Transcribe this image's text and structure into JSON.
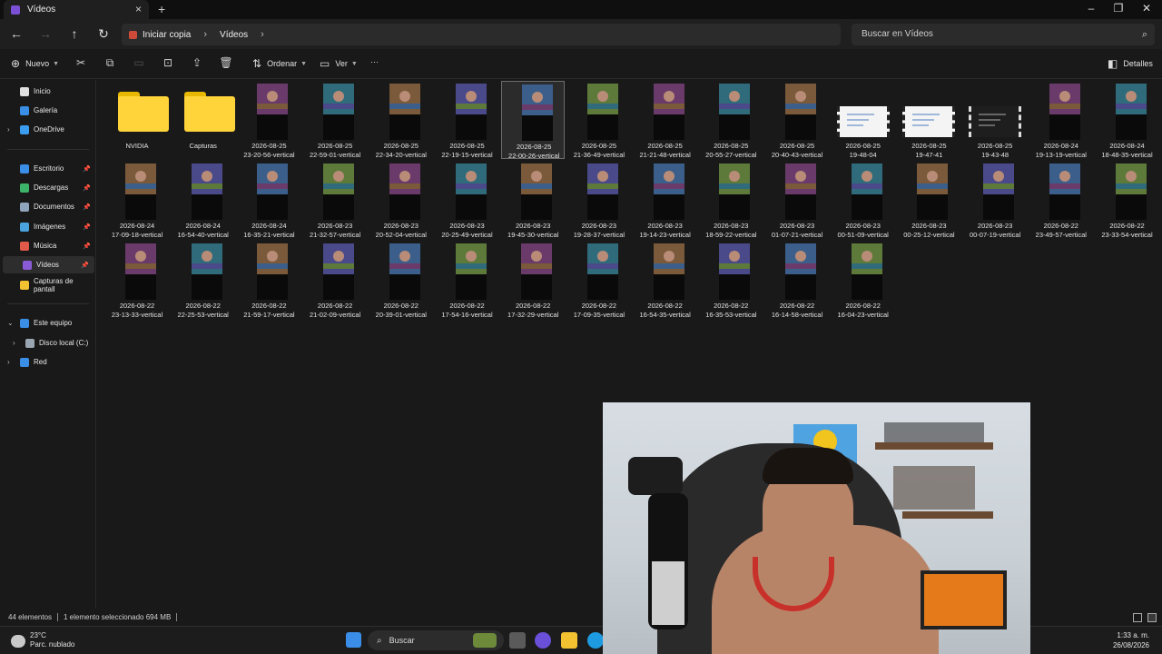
{
  "window": {
    "tab_title": "Vídeos",
    "new_tab": "+",
    "close_tab": "×",
    "minimize": "–",
    "maximize": "❐",
    "close": "✕"
  },
  "nav": {
    "back": "←",
    "forward": "→",
    "up": "↑",
    "refresh": "↻",
    "breadcrumbs": [
      "Iniciar copia",
      "Vídeos"
    ],
    "search_placeholder": "Buscar en Vídeos"
  },
  "commandbar": {
    "new_label": "Nuevo",
    "sort_label": "Ordenar",
    "view_label": "Ver",
    "more_label": "···",
    "details_label": "Detalles",
    "icons": [
      "cut-icon",
      "copy-icon",
      "paste-icon",
      "rename-icon",
      "share-icon",
      "delete-icon"
    ]
  },
  "sidebar": {
    "items": [
      {
        "label": "Inicio",
        "icon": "home-icon",
        "color": "#e0e0e0"
      },
      {
        "label": "Galería",
        "icon": "gallery-icon",
        "color": "#3a8ee6"
      },
      {
        "label": "OneDrive",
        "icon": "cloud-icon",
        "color": "#3b9cf0"
      },
      {
        "label": "Escritorio",
        "icon": "desktop-icon",
        "color": "#3a8ee6"
      },
      {
        "label": "Descargas",
        "icon": "download-icon",
        "color": "#3db36a"
      },
      {
        "label": "Documentos",
        "icon": "documents-icon",
        "color": "#8fa4bd"
      },
      {
        "label": "Imágenes",
        "icon": "pictures-icon",
        "color": "#4aa3df"
      },
      {
        "label": "Música",
        "icon": "music-icon",
        "color": "#e35a4a"
      },
      {
        "label": "Vídeos",
        "icon": "videos-icon",
        "color": "#8a5bd6"
      },
      {
        "label": "Capturas de pantall",
        "icon": "folder-icon",
        "color": "#f2c230"
      },
      {
        "label": "Este equipo",
        "icon": "computer-icon",
        "color": "#3a8ee6"
      },
      {
        "label": "Disco local (C:)",
        "icon": "drive-icon",
        "color": "#9aa6b2"
      },
      {
        "label": "Red",
        "icon": "network-icon",
        "color": "#3a8ee6"
      }
    ]
  },
  "files": [
    {
      "name": "NVIDIA",
      "kind": "folder"
    },
    {
      "name": "Capturas",
      "kind": "folder"
    },
    {
      "name": "2026-08-25\n23-20-56-vertical",
      "kind": "video"
    },
    {
      "name": "2026-08-25\n22-59-01-vertical",
      "kind": "video"
    },
    {
      "name": "2026-08-25\n22-34-20-vertical",
      "kind": "video"
    },
    {
      "name": "2026-08-25\n22-19-15-vertical",
      "kind": "video"
    },
    {
      "name": "2026-08-25\n22-00-26-vertical",
      "kind": "video",
      "selected": true
    },
    {
      "name": "2026-08-25\n21-36-49-vertical",
      "kind": "video"
    },
    {
      "name": "2026-08-25\n21-21-48-vertical",
      "kind": "video"
    },
    {
      "name": "2026-08-25\n20-55-27-vertical",
      "kind": "video"
    },
    {
      "name": "2026-08-25\n20-40-43-vertical",
      "kind": "video"
    },
    {
      "name": "2026-08-25\n19-48-04",
      "kind": "doc"
    },
    {
      "name": "2026-08-25\n19-47-41",
      "kind": "doc"
    },
    {
      "name": "2026-08-25\n19-43-48",
      "kind": "docdark"
    },
    {
      "name": "2026-08-24\n19-13-19-vertical",
      "kind": "video"
    },
    {
      "name": "2026-08-24\n18-48-35-vertical",
      "kind": "video"
    },
    {
      "name": "2026-08-24\n17-09-18-vertical",
      "kind": "video"
    },
    {
      "name": "2026-08-24\n16-54-40-vertical",
      "kind": "video"
    },
    {
      "name": "2026-08-24\n16-35-21-vertical",
      "kind": "video"
    },
    {
      "name": "2026-08-23\n21-32-57-vertical",
      "kind": "video"
    },
    {
      "name": "2026-08-23\n20-52-04-vertical",
      "kind": "video"
    },
    {
      "name": "2026-08-23\n20-25-49-vertical",
      "kind": "video"
    },
    {
      "name": "2026-08-23\n19-45-30-vertical",
      "kind": "video"
    },
    {
      "name": "2026-08-23\n19-28-37-vertical",
      "kind": "video"
    },
    {
      "name": "2026-08-23\n19-14-23-vertical",
      "kind": "video"
    },
    {
      "name": "2026-08-23\n18-59-22-vertical",
      "kind": "video"
    },
    {
      "name": "2026-08-23\n01-07-21-vertical",
      "kind": "video"
    },
    {
      "name": "2026-08-23\n00-51-09-vertical",
      "kind": "video"
    },
    {
      "name": "2026-08-23\n00-25-12-vertical",
      "kind": "video"
    },
    {
      "name": "2026-08-23\n00-07-19-vertical",
      "kind": "video"
    },
    {
      "name": "2026-08-22\n23-49-57-vertical",
      "kind": "video"
    },
    {
      "name": "2026-08-22\n23-33-54-vertical",
      "kind": "video"
    },
    {
      "name": "2026-08-22\n23-13-33-vertical",
      "kind": "video"
    },
    {
      "name": "2026-08-22\n22-25-53-vertical",
      "kind": "video"
    },
    {
      "name": "2026-08-22\n21-59-17-vertical",
      "kind": "video"
    },
    {
      "name": "2026-08-22\n21-02-09-vertical",
      "kind": "video"
    },
    {
      "name": "2026-08-22\n20-39-01-vertical",
      "kind": "video"
    },
    {
      "name": "2026-08-22\n17-54-16-vertical",
      "kind": "video"
    },
    {
      "name": "2026-08-22\n17-32-29-vertical",
      "kind": "video"
    },
    {
      "name": "2026-08-22\n17-09-35-vertical",
      "kind": "video"
    },
    {
      "name": "2026-08-22\n16-54-35-vertical",
      "kind": "video"
    },
    {
      "name": "2026-08-22\n16-35-53-vertical",
      "kind": "video"
    },
    {
      "name": "2026-08-22\n16-14-58-vertical",
      "kind": "video"
    },
    {
      "name": "2026-08-22\n16-04-23-vertical",
      "kind": "video"
    }
  ],
  "status": {
    "count": "44 elementos",
    "selection": "1 elemento seleccionado  694 MB"
  },
  "taskbar": {
    "temperature": "23°C",
    "weather": "Parc. nublado",
    "search_label": "Buscar",
    "time": "1:33 a. m.",
    "date": "26/08/2026"
  },
  "colors": {
    "background": "#191919",
    "accent_video": "#8a5bd6",
    "folder_yellow": "#ffd43b"
  }
}
